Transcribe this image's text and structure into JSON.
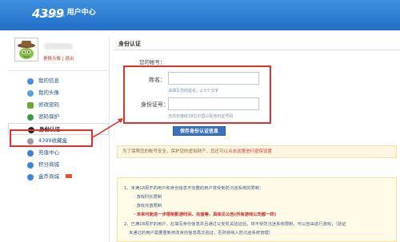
{
  "header": {
    "logo_number": "4399",
    "logo_title": "用户中心",
    "logo_url": "u.4399.com"
  },
  "profile": {
    "link_change_avatar": "更换头像",
    "link_separator": "|",
    "link_logout": "退出"
  },
  "sidebar": {
    "items": [
      {
        "label": "我的信息",
        "icon": "user-info-icon"
      },
      {
        "label": "我的头像",
        "icon": "avatar-icon"
      },
      {
        "label": "修改密码",
        "icon": "lock-icon"
      },
      {
        "label": "密码保护",
        "icon": "shield-icon"
      },
      {
        "label": "身份认证",
        "icon": "person-icon"
      },
      {
        "label": "4399收藏盒",
        "icon": "star-icon"
      },
      {
        "label": "充值中心",
        "icon": "coin-icon"
      },
      {
        "label": "积分商城",
        "icon": "gift-icon"
      },
      {
        "label": "盒币商城",
        "icon": "box-icon"
      }
    ]
  },
  "main": {
    "title": "身份认证",
    "account_label": "您的帐号：",
    "name_label": "姓名：",
    "name_hint": "请填写您的姓名，2-5个汉字",
    "id_label": "身份证号：",
    "id_hint": "当前仅接收18位中国公民身份证号码",
    "save_button": "保存身份认证信息",
    "notice_text": "为了保障您的帐号安全，保护您的虚拟财产，您还可以",
    "notice_link": "点击这里进行密保设置",
    "info_lines": [
      "1、未满18周岁的用户和身份信息不完整的用户将受到防沉迷系统的限制：",
      "· 游戏时长限制",
      "· 游戏充值限制",
      "· 未来可能进一步限制影游时间、充值等，具体见公告(所有游戏公司都一样)",
      "2、已满18周岁的用户，在填写身份信息并且通过公安机关验证后，将不受防沉迷系统限制，可以自由进行游戏；（验证",
      "未通过的用户需要重新修改身份信息再次验证，否则将纳入防沉迷系统管理）"
    ]
  },
  "colors": {
    "header_top": "#3f8fe0",
    "header_bottom": "#1f6fc8",
    "accent_red": "#e03232",
    "button_blue": "#3a72bd"
  }
}
